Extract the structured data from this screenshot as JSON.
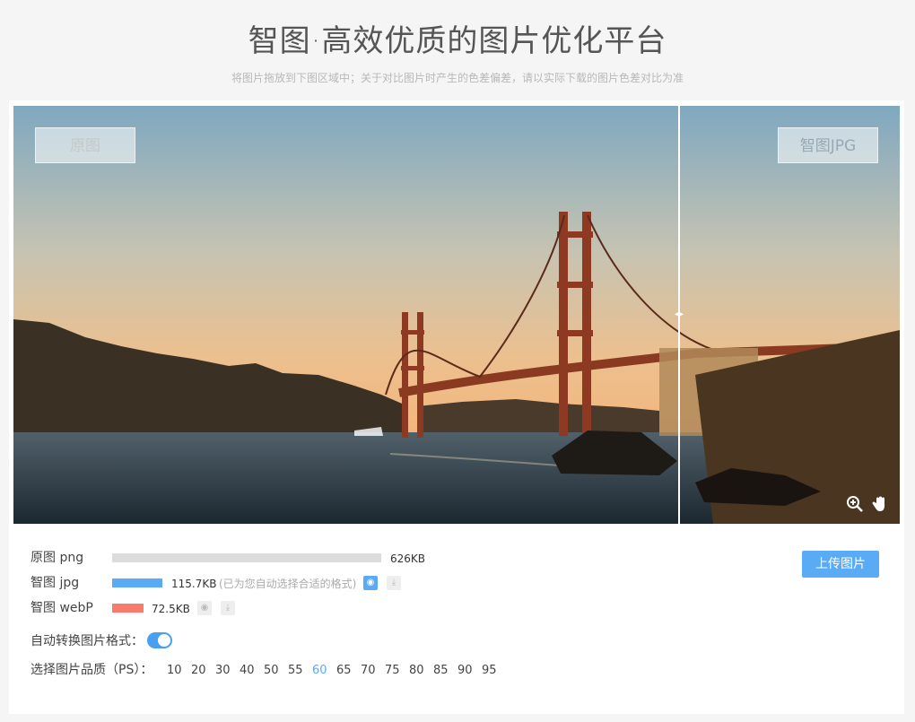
{
  "header": {
    "title": "智图·高效优质的图片优化平台",
    "subtitle": "将图片拖放到下图区域中；关于对比图片时产生的色差偏差，请以实际下载的图片色差对比为准"
  },
  "viewer": {
    "left_tag": "原图",
    "right_tag": "智图JPG",
    "split_position": 0.75
  },
  "results": [
    {
      "label": "原图 png",
      "size": "626KB",
      "bar_fraction": 1.0,
      "bar_color": "#dcdcdc"
    },
    {
      "label": "智图 jpg",
      "size": "115.7KB",
      "note": "(已为您自动选择合适的格式)",
      "bar_fraction": 0.185,
      "bar_color": "#5aabf6"
    },
    {
      "label": "智图 webP",
      "size": "72.5KB",
      "bar_fraction": 0.116,
      "bar_color": "#f87c6c"
    }
  ],
  "actions": {
    "upload_label": "上传图片"
  },
  "auto_convert": {
    "label": "自动转换图片格式：",
    "enabled": true
  },
  "quality": {
    "label": "选择图片品质（PS）：",
    "options": [
      "10",
      "20",
      "30",
      "40",
      "50",
      "55",
      "60",
      "65",
      "70",
      "75",
      "80",
      "85",
      "90",
      "95"
    ],
    "selected": "60"
  },
  "colors": {
    "accent": "#5aabf6",
    "webp_bar": "#f87c6c",
    "original_bar": "#dcdcdc"
  },
  "icons": {
    "preview": "eye-icon",
    "download": "download-icon",
    "zoom": "zoom-in-icon",
    "pan": "hand-icon"
  }
}
